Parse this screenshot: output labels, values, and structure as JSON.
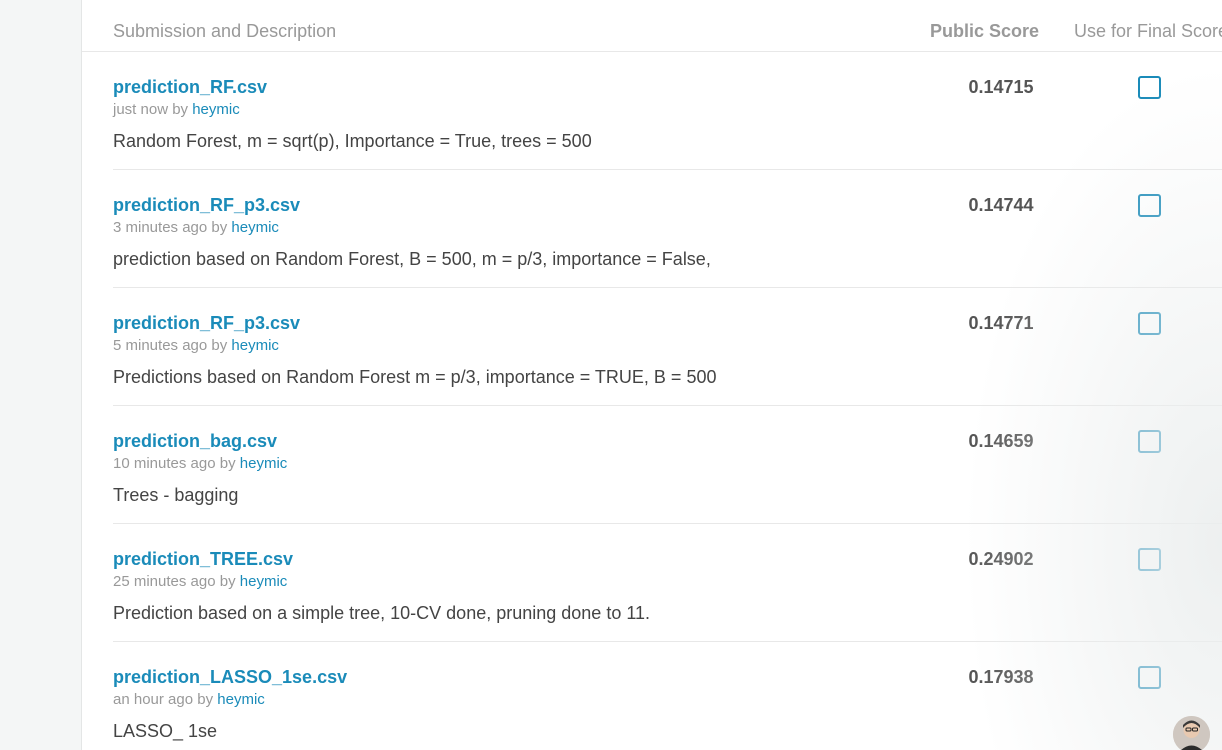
{
  "header": {
    "col_description": "Submission and Description",
    "col_public_score": "Public Score",
    "col_final": "Use for Final Score"
  },
  "submissions": [
    {
      "file": "prediction_RF.csv",
      "time": "just now",
      "by": "by",
      "author": "heymic",
      "description": "Random Forest, m = sqrt(p), Importance = True, trees = 500",
      "score": "0.14715",
      "selected": false
    },
    {
      "file": "prediction_RF_p3.csv",
      "time": "3 minutes ago",
      "by": "by",
      "author": "heymic",
      "description": "prediction based on Random Forest, B = 500, m = p/3, importance = False,",
      "score": "0.14744",
      "selected": false
    },
    {
      "file": "prediction_RF_p3.csv",
      "time": "5 minutes ago",
      "by": "by",
      "author": "heymic",
      "description": "Predictions based on Random Forest m = p/3, importance = TRUE, B = 500",
      "score": "0.14771",
      "selected": false
    },
    {
      "file": "prediction_bag.csv",
      "time": "10 minutes ago",
      "by": "by",
      "author": "heymic",
      "description": "Trees - bagging",
      "score": "0.14659",
      "selected": false
    },
    {
      "file": "prediction_TREE.csv",
      "time": "25 minutes ago",
      "by": "by",
      "author": "heymic",
      "description": "Prediction based on a simple tree, 10-CV done, pruning done to 11.",
      "score": "0.24902",
      "selected": false
    },
    {
      "file": "prediction_LASSO_1se.csv",
      "time": "an hour ago",
      "by": "by",
      "author": "heymic",
      "description": "LASSO_ 1se",
      "score": "0.17938",
      "selected": false
    }
  ],
  "colors": {
    "link": "#1a8bb9",
    "muted": "#999999",
    "text": "#444444"
  },
  "icons": {
    "avatar": "user-avatar-icon",
    "checkbox": "checkbox-icon"
  }
}
